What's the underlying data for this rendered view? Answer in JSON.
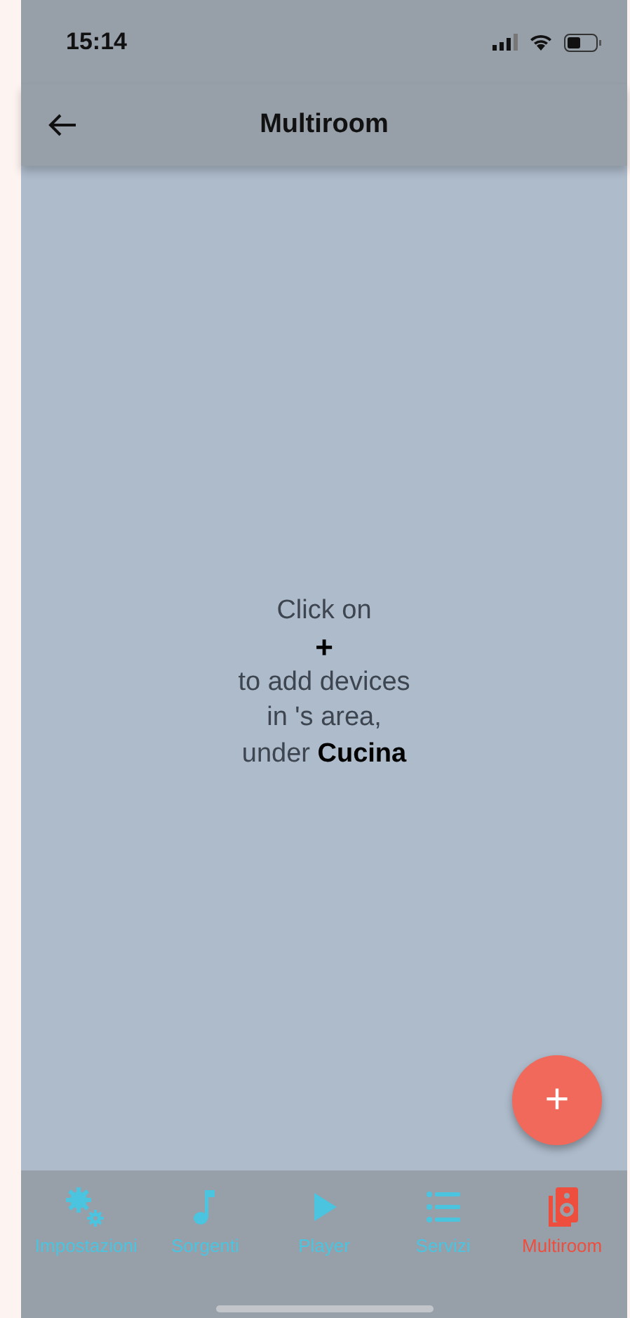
{
  "status_bar": {
    "time": "15:14"
  },
  "header": {
    "title": "Multiroom"
  },
  "message": {
    "lines": [
      "Click on",
      "+",
      "to add devices",
      "in 's area,",
      "under **Cucina**"
    ]
  },
  "fab": {
    "label": "+"
  },
  "tab_bar": [
    {
      "label": "Impostazioni",
      "kind": "settings",
      "selected": false
    },
    {
      "label": "Sorgenti",
      "kind": "music",
      "selected": false
    },
    {
      "label": "Player",
      "kind": "play",
      "selected": false
    },
    {
      "label": "Servizi",
      "kind": "list",
      "selected": false
    },
    {
      "label": "Multiroom",
      "kind": "speaker",
      "selected": true
    }
  ]
}
